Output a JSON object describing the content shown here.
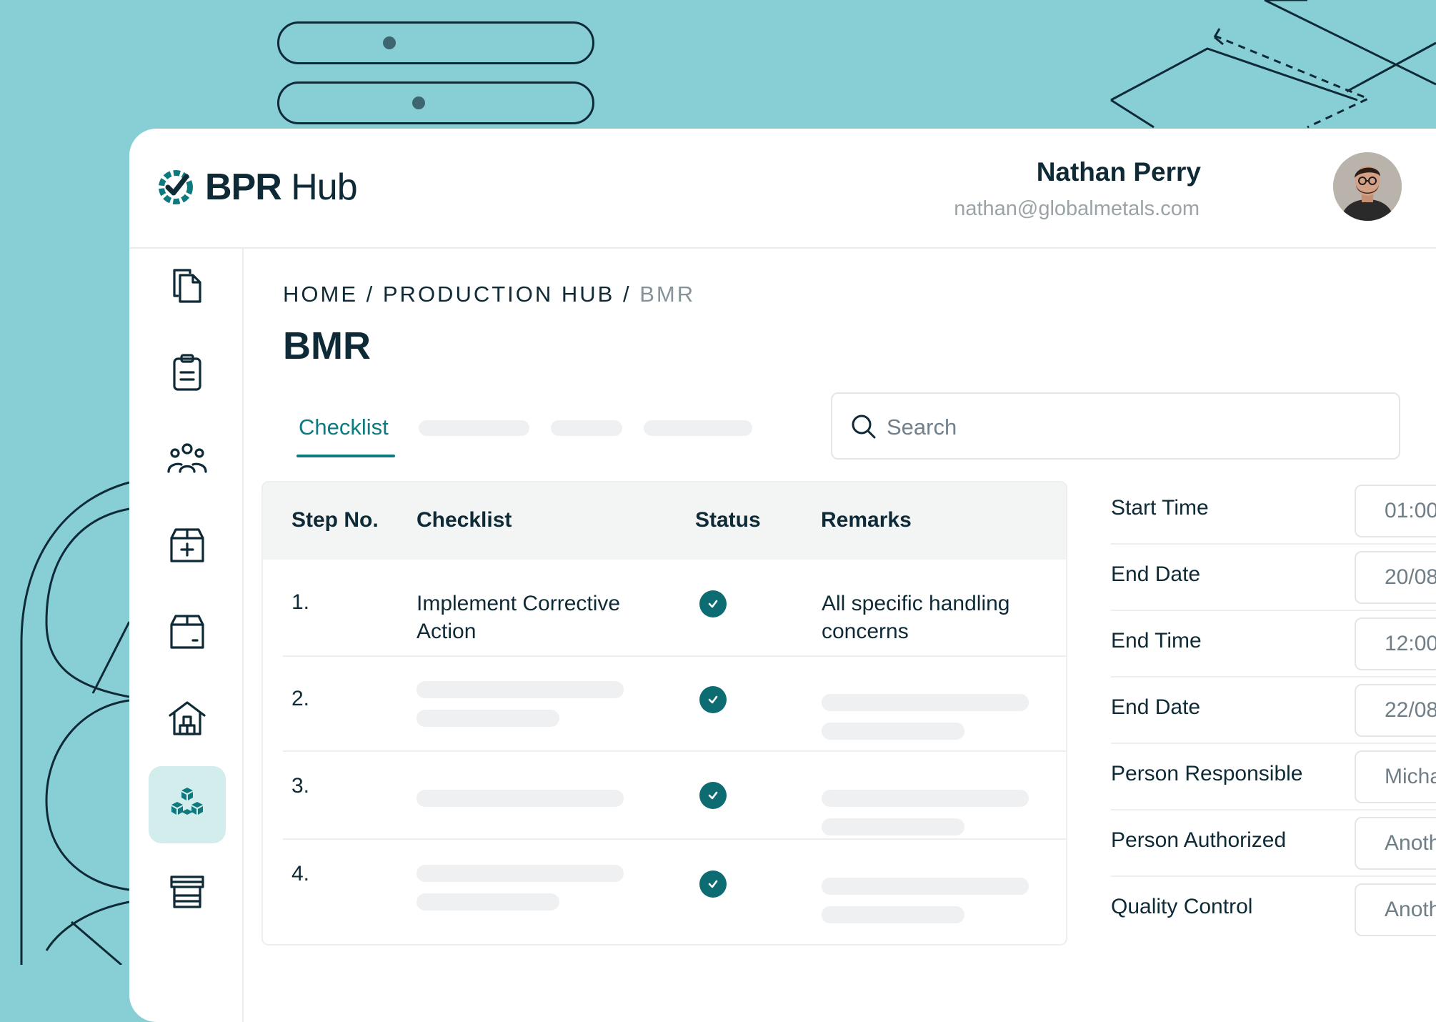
{
  "colors": {
    "background": "#87cfd4",
    "accent": "#0d7a80",
    "text_dark": "#0e2a36",
    "active_nav_bg": "#d3ecec"
  },
  "header": {
    "logo_bold": "BPR",
    "logo_light": "Hub",
    "user_name": "Nathan Perry",
    "user_email": "nathan@globalmetals.com"
  },
  "sidebar": {
    "items": [
      {
        "icon": "documents-icon"
      },
      {
        "icon": "clipboard-icon"
      },
      {
        "icon": "team-icon"
      },
      {
        "icon": "add-package-icon"
      },
      {
        "icon": "archive-box-icon"
      },
      {
        "icon": "warehouse-icon"
      },
      {
        "icon": "production-hub-icon",
        "active": true
      },
      {
        "icon": "store-icon"
      }
    ]
  },
  "breadcrumb": {
    "home": "HOME",
    "sep1": "/",
    "hub": "PRODUCTION HUB",
    "sep2": "/",
    "current": "BMR"
  },
  "page": {
    "title": "BMR"
  },
  "tabs": {
    "active": "Checklist"
  },
  "search": {
    "placeholder": "Search"
  },
  "table": {
    "headers": {
      "step": "Step No.",
      "checklist": "Checklist",
      "status": "Status",
      "remarks": "Remarks"
    },
    "rows": [
      {
        "step": "1.",
        "checklist_line1": "Implement Corrective",
        "checklist_line2": "Action",
        "status": "complete",
        "remarks_line1": "All specific handling",
        "remarks_line2": "concerns"
      },
      {
        "step": "2.",
        "status": "complete"
      },
      {
        "step": "3.",
        "status": "complete"
      },
      {
        "step": "4.",
        "status": "complete"
      }
    ]
  },
  "details": [
    {
      "label": "Start Time",
      "value": "01:00"
    },
    {
      "label": "End Date",
      "value": "20/08"
    },
    {
      "label": "End Time",
      "value": "12:00"
    },
    {
      "label": "End Date",
      "value": "22/08"
    },
    {
      "label": "Person Responsible",
      "value": "Micha"
    },
    {
      "label": "Person Authorized",
      "value": "Anoth"
    },
    {
      "label": "Quality Control",
      "value": "Anoth"
    }
  ]
}
